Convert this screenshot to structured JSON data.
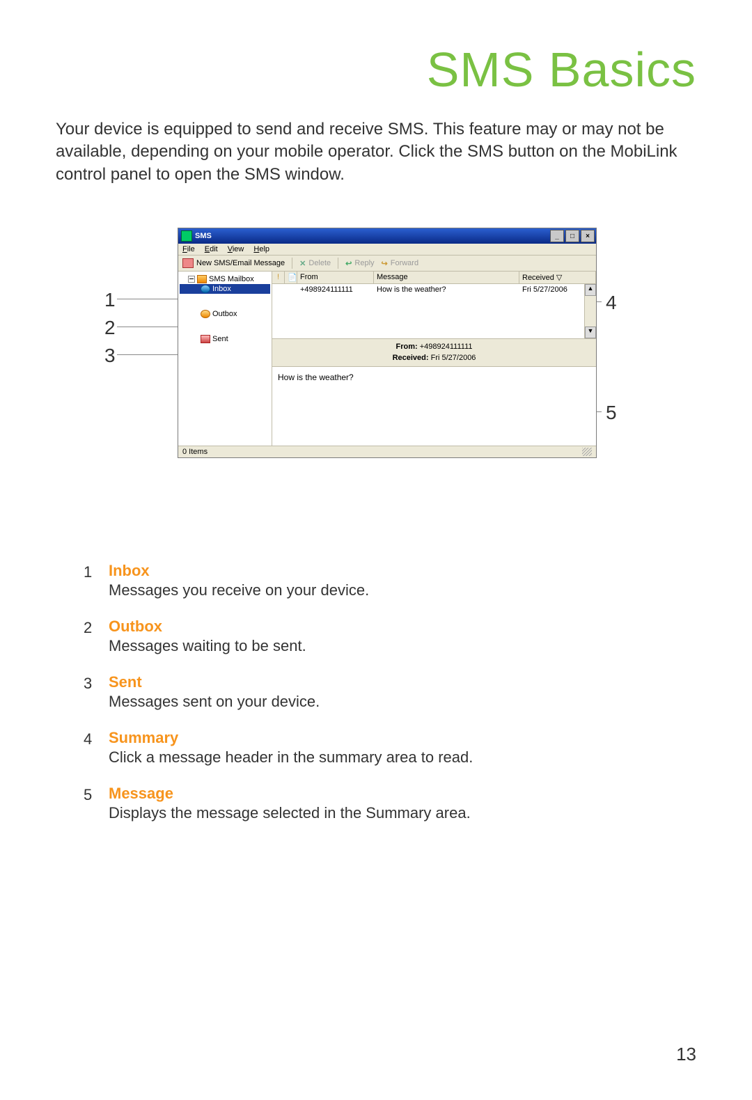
{
  "page": {
    "title": "SMS Basics",
    "intro": "Your device is equipped to send and receive SMS. This feature may or may not be available, depending on your mobile operator. Click the SMS button on the MobiLink control panel to open the SMS window.",
    "number": "13"
  },
  "screenshot": {
    "window_title": "SMS",
    "menu": {
      "file": "File",
      "edit": "Edit",
      "view": "View",
      "help": "Help"
    },
    "toolbar": {
      "new": "New SMS/Email Message",
      "delete": "Delete",
      "reply": "Reply",
      "forward": "Forward"
    },
    "tree": {
      "root": "SMS Mailbox",
      "inbox": "Inbox",
      "outbox": "Outbox",
      "sent": "Sent"
    },
    "list": {
      "col_from": "From",
      "col_message": "Message",
      "col_received": "Received",
      "row": {
        "from": "+498924111111",
        "message": "How is the weather?",
        "received": "Fri 5/27/2006"
      }
    },
    "preview": {
      "from_label": "From:",
      "from_value": "+498924111111",
      "received_label": "Received:",
      "received_value": "Fri 5/27/2006",
      "body": "How is the weather?"
    },
    "status": "0 Items"
  },
  "callouts": {
    "c1": "1",
    "c2": "2",
    "c3": "3",
    "c4": "4",
    "c5": "5"
  },
  "legend": [
    {
      "num": "1",
      "title": "Inbox",
      "desc": "Messages you receive on your device."
    },
    {
      "num": "2",
      "title": "Outbox",
      "desc": "Messages waiting to be sent."
    },
    {
      "num": "3",
      "title": "Sent",
      "desc": "Messages sent on your device."
    },
    {
      "num": "4",
      "title": "Summary",
      "desc": "Click a message header in the summary area to read."
    },
    {
      "num": "5",
      "title": "Message",
      "desc": "Displays the message selected in the Summary area."
    }
  ]
}
